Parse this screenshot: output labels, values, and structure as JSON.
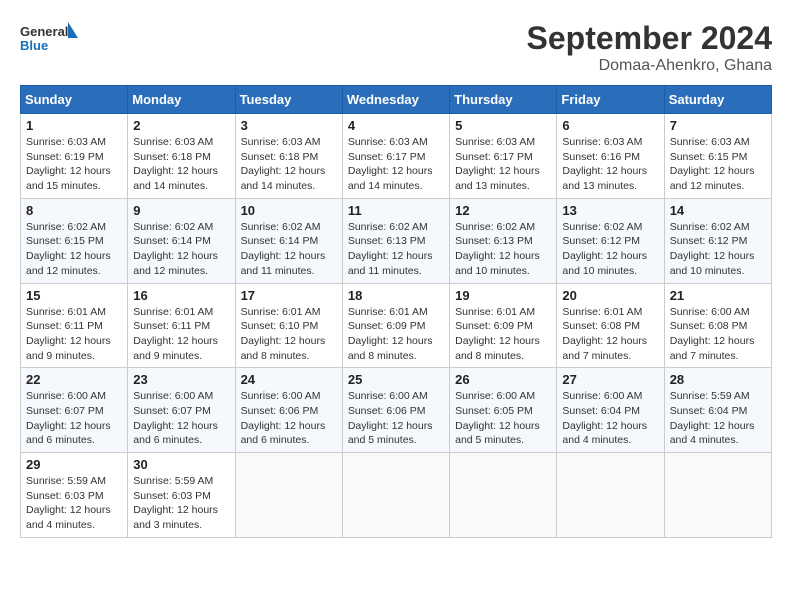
{
  "logo": {
    "name_part1": "General",
    "name_part2": "Blue"
  },
  "title": "September 2024",
  "subtitle": "Domaa-Ahenkro, Ghana",
  "weekdays": [
    "Sunday",
    "Monday",
    "Tuesday",
    "Wednesday",
    "Thursday",
    "Friday",
    "Saturday"
  ],
  "weeks": [
    [
      {
        "day": "1",
        "sunrise": "6:03 AM",
        "sunset": "6:19 PM",
        "daylight": "12 hours and 15 minutes."
      },
      {
        "day": "2",
        "sunrise": "6:03 AM",
        "sunset": "6:18 PM",
        "daylight": "12 hours and 14 minutes."
      },
      {
        "day": "3",
        "sunrise": "6:03 AM",
        "sunset": "6:18 PM",
        "daylight": "12 hours and 14 minutes."
      },
      {
        "day": "4",
        "sunrise": "6:03 AM",
        "sunset": "6:17 PM",
        "daylight": "12 hours and 14 minutes."
      },
      {
        "day": "5",
        "sunrise": "6:03 AM",
        "sunset": "6:17 PM",
        "daylight": "12 hours and 13 minutes."
      },
      {
        "day": "6",
        "sunrise": "6:03 AM",
        "sunset": "6:16 PM",
        "daylight": "12 hours and 13 minutes."
      },
      {
        "day": "7",
        "sunrise": "6:03 AM",
        "sunset": "6:15 PM",
        "daylight": "12 hours and 12 minutes."
      }
    ],
    [
      {
        "day": "8",
        "sunrise": "6:02 AM",
        "sunset": "6:15 PM",
        "daylight": "12 hours and 12 minutes."
      },
      {
        "day": "9",
        "sunrise": "6:02 AM",
        "sunset": "6:14 PM",
        "daylight": "12 hours and 12 minutes."
      },
      {
        "day": "10",
        "sunrise": "6:02 AM",
        "sunset": "6:14 PM",
        "daylight": "12 hours and 11 minutes."
      },
      {
        "day": "11",
        "sunrise": "6:02 AM",
        "sunset": "6:13 PM",
        "daylight": "12 hours and 11 minutes."
      },
      {
        "day": "12",
        "sunrise": "6:02 AM",
        "sunset": "6:13 PM",
        "daylight": "12 hours and 10 minutes."
      },
      {
        "day": "13",
        "sunrise": "6:02 AM",
        "sunset": "6:12 PM",
        "daylight": "12 hours and 10 minutes."
      },
      {
        "day": "14",
        "sunrise": "6:02 AM",
        "sunset": "6:12 PM",
        "daylight": "12 hours and 10 minutes."
      }
    ],
    [
      {
        "day": "15",
        "sunrise": "6:01 AM",
        "sunset": "6:11 PM",
        "daylight": "12 hours and 9 minutes."
      },
      {
        "day": "16",
        "sunrise": "6:01 AM",
        "sunset": "6:11 PM",
        "daylight": "12 hours and 9 minutes."
      },
      {
        "day": "17",
        "sunrise": "6:01 AM",
        "sunset": "6:10 PM",
        "daylight": "12 hours and 8 minutes."
      },
      {
        "day": "18",
        "sunrise": "6:01 AM",
        "sunset": "6:09 PM",
        "daylight": "12 hours and 8 minutes."
      },
      {
        "day": "19",
        "sunrise": "6:01 AM",
        "sunset": "6:09 PM",
        "daylight": "12 hours and 8 minutes."
      },
      {
        "day": "20",
        "sunrise": "6:01 AM",
        "sunset": "6:08 PM",
        "daylight": "12 hours and 7 minutes."
      },
      {
        "day": "21",
        "sunrise": "6:00 AM",
        "sunset": "6:08 PM",
        "daylight": "12 hours and 7 minutes."
      }
    ],
    [
      {
        "day": "22",
        "sunrise": "6:00 AM",
        "sunset": "6:07 PM",
        "daylight": "12 hours and 6 minutes."
      },
      {
        "day": "23",
        "sunrise": "6:00 AM",
        "sunset": "6:07 PM",
        "daylight": "12 hours and 6 minutes."
      },
      {
        "day": "24",
        "sunrise": "6:00 AM",
        "sunset": "6:06 PM",
        "daylight": "12 hours and 6 minutes."
      },
      {
        "day": "25",
        "sunrise": "6:00 AM",
        "sunset": "6:06 PM",
        "daylight": "12 hours and 5 minutes."
      },
      {
        "day": "26",
        "sunrise": "6:00 AM",
        "sunset": "6:05 PM",
        "daylight": "12 hours and 5 minutes."
      },
      {
        "day": "27",
        "sunrise": "6:00 AM",
        "sunset": "6:04 PM",
        "daylight": "12 hours and 4 minutes."
      },
      {
        "day": "28",
        "sunrise": "5:59 AM",
        "sunset": "6:04 PM",
        "daylight": "12 hours and 4 minutes."
      }
    ],
    [
      {
        "day": "29",
        "sunrise": "5:59 AM",
        "sunset": "6:03 PM",
        "daylight": "12 hours and 4 minutes."
      },
      {
        "day": "30",
        "sunrise": "5:59 AM",
        "sunset": "6:03 PM",
        "daylight": "12 hours and 3 minutes."
      },
      null,
      null,
      null,
      null,
      null
    ]
  ]
}
